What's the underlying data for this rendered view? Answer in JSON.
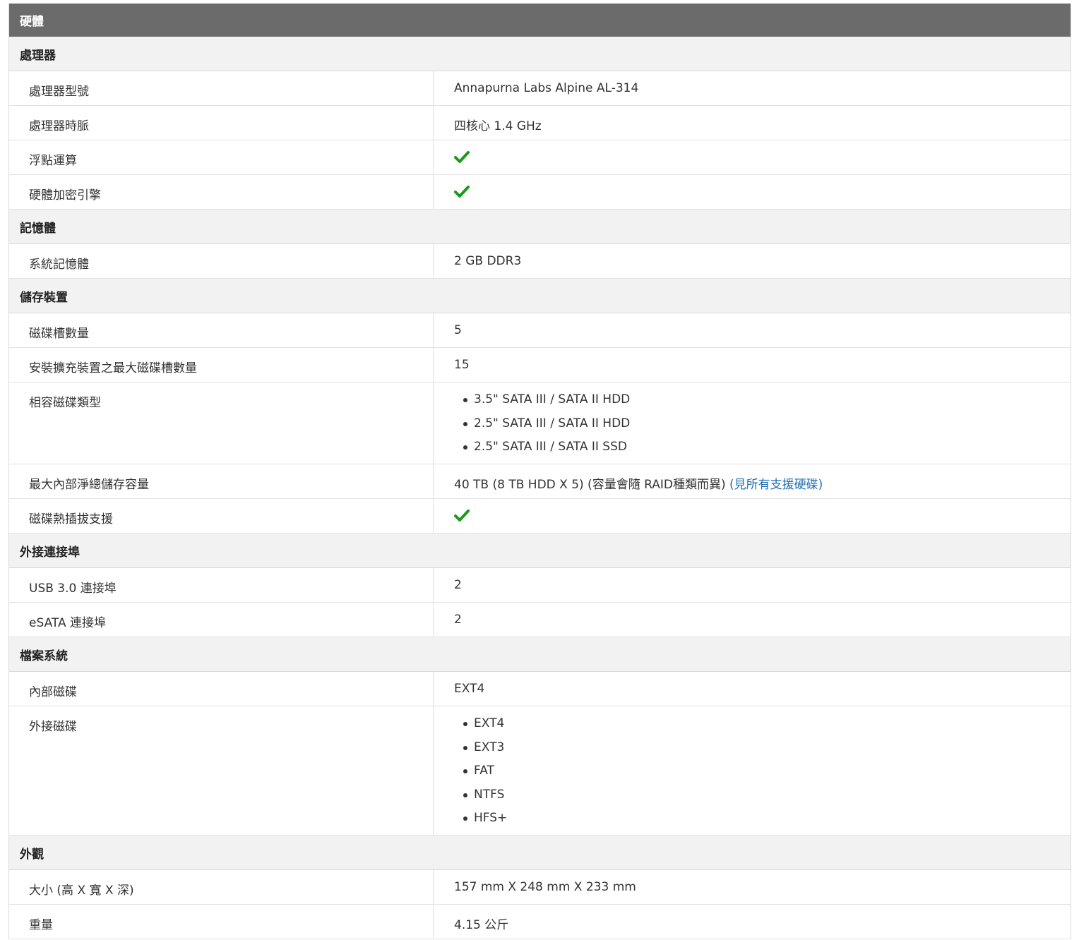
{
  "title": "硬體",
  "sections": {
    "processor": {
      "title": "處理器",
      "model_label": "處理器型號",
      "model_value": "Annapurna Labs Alpine AL-314",
      "freq_label": "處理器時脈",
      "freq_value": "四核心 1.4 GHz",
      "fp_label": "浮點運算",
      "crypto_label": "硬體加密引擎"
    },
    "memory": {
      "title": "記憶體",
      "sys_label": "系統記憶體",
      "sys_value": "2 GB DDR3"
    },
    "storage": {
      "title": "儲存裝置",
      "bays_label": "磁碟槽數量",
      "bays_value": "5",
      "max_bays_label": "安裝擴充裝置之最大磁碟槽數量",
      "max_bays_value": "15",
      "types_label": "相容磁碟類型",
      "types": [
        "3.5\" SATA III / SATA II HDD",
        "2.5\" SATA III / SATA II HDD",
        "2.5\" SATA III / SATA II SSD"
      ],
      "capacity_label": "最大內部淨總儲存容量",
      "capacity_value": "40 TB (8 TB HDD X 5) (容量會隨 RAID種類而異)",
      "capacity_link": "(見所有支援硬碟)",
      "hotswap_label": "磁碟熱插拔支援"
    },
    "ports": {
      "title": "外接連接埠",
      "usb_label": "USB 3.0 連接埠",
      "usb_value": "2",
      "esata_label": "eSATA 連接埠",
      "esata_value": "2"
    },
    "filesystem": {
      "title": "檔案系統",
      "internal_label": "內部磁碟",
      "internal_value": "EXT4",
      "external_label": "外接磁碟",
      "external": [
        "EXT4",
        "EXT3",
        "FAT",
        "NTFS",
        "HFS+"
      ]
    },
    "appearance": {
      "title": "外觀",
      "size_label": "大小 (高 X 寬 X 深)",
      "size_value": "157 mm X 248 mm X 233 mm",
      "weight_label": "重量",
      "weight_value": "4.15 公斤"
    }
  },
  "colors": {
    "header_bg": "#6b6b6b",
    "section_bg": "#f2f2f2",
    "check": "#1a9a1a",
    "link": "#1f6fb5"
  }
}
